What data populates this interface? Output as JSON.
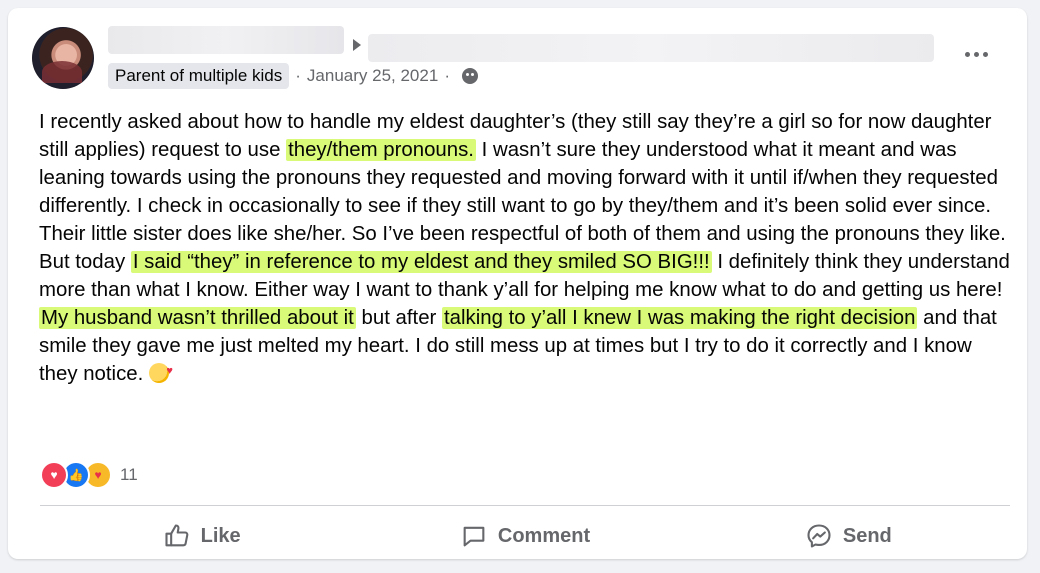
{
  "post": {
    "member_badge": "Parent of multiple kids",
    "separator": "·",
    "date": "January 25, 2021",
    "text_segments": [
      "I recently asked about how to handle my eldest daughter’s (they still say they’re a girl so for now daughter still applies) request to use ",
      "they/them pronouns.",
      " I wasn’t sure they understood what it meant and was leaning towards using the pronouns they requested and moving forward with it until if/when they requested differently. I check in occasionally to see if they still want to go by they/them and it’s been solid ever since. Their little sister does like she/her. So I’ve been respectful of both of them and using the pronouns they like. But today ",
      "I said “they” in reference to my eldest and they smiled SO BIG!!!",
      " I definitely think they understand more than what I know. Either way I want to thank y’all for helping me know what to do and getting us here! ",
      "My husband wasn’t thrilled about it",
      " but after ",
      "talking to y’all I knew I was making the right decision",
      " and that smile they gave me just melted my heart. I do still mess up at times but I try to do it correctly and I know they notice. "
    ],
    "highlight_color": "#d8fa78",
    "end_emoji_icon": "smiling-face-with-hearts-icon"
  },
  "reactions": {
    "icons": [
      "love-icon",
      "like-icon",
      "care-icon"
    ],
    "count": "11"
  },
  "actions": {
    "like_label": "Like",
    "comment_label": "Comment",
    "send_label": "Send"
  }
}
